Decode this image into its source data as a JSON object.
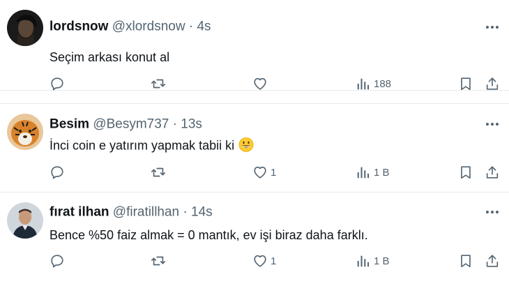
{
  "tweets": [
    {
      "name": "lordsnow",
      "handle": "@xlordsnow",
      "separator": "·",
      "time": "4s",
      "text": "Seçim arkası konut al",
      "likes": "",
      "views": "188",
      "avatar": "dark-portrait-avatar"
    },
    {
      "name": "Besim",
      "handle": "@Besym737",
      "separator": "·",
      "time": "13s",
      "text": "İnci coin e yatırım yapmak tabii ki",
      "emoji": "grinning-face-emoji",
      "likes": "1",
      "views": "1 B",
      "avatar": "tiger-avatar"
    },
    {
      "name": "fırat ilhan",
      "handle": "@firatillhan",
      "separator": "·",
      "time": "14s",
      "text": "Bence %50 faiz almak = 0 mantık, ev işi biraz daha farklı.",
      "likes": "1",
      "views": "1 B",
      "avatar": "man-portrait-avatar"
    }
  ],
  "colors": {
    "text": "#0f1419",
    "secondary": "#536471",
    "divider": "#e6e9ec"
  }
}
